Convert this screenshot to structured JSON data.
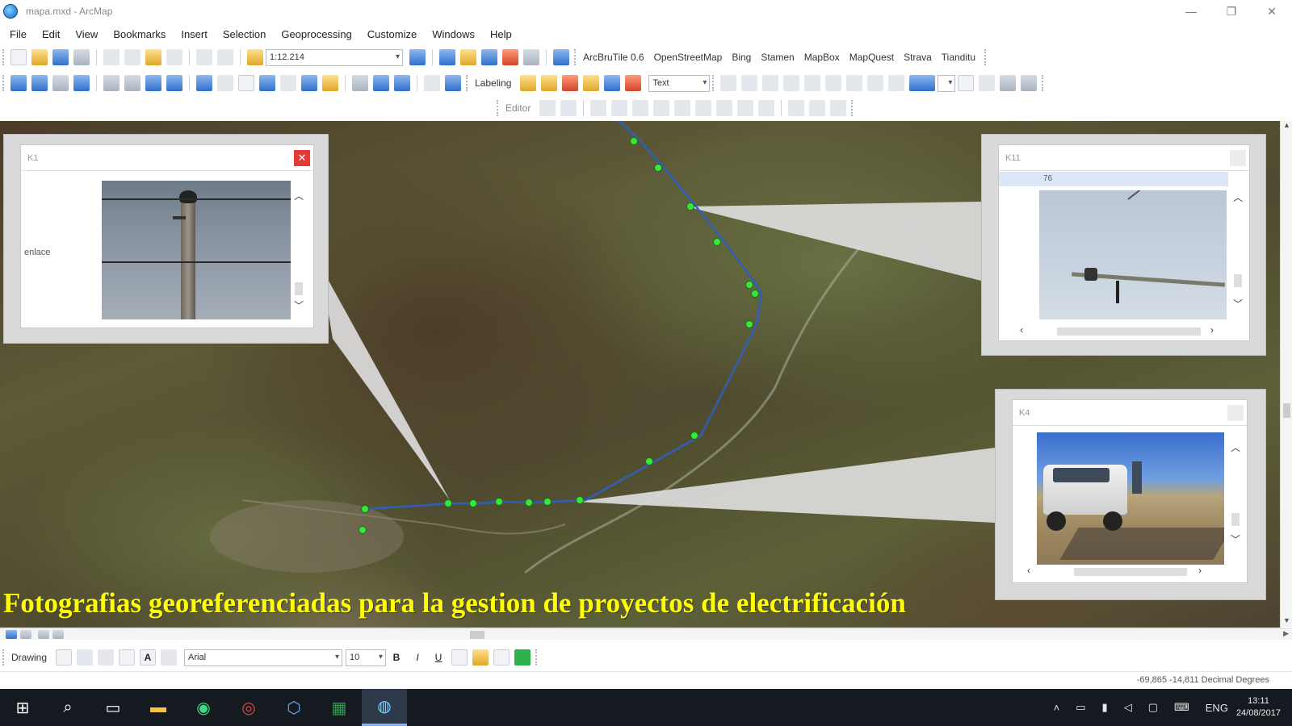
{
  "window": {
    "title": "mapa.mxd - ArcMap",
    "minimize": "—",
    "maximize": "❐",
    "close": "✕"
  },
  "menu": [
    "File",
    "Edit",
    "View",
    "Bookmarks",
    "Insert",
    "Selection",
    "Geoprocessing",
    "Customize",
    "Windows",
    "Help"
  ],
  "standard_toolbar": {
    "scale_value": "1:12.214",
    "arcbrutile_label": "ArcBruTile 0.6",
    "basemap_menus": [
      "OpenStreetMap",
      "Bing",
      "Stamen",
      "MapBox",
      "MapQuest",
      "Strava",
      "Tianditu"
    ]
  },
  "labeling_toolbar": {
    "label": "Labeling",
    "font_value": "Text"
  },
  "editor_toolbar": {
    "label": "Editor"
  },
  "map": {
    "caption": "Fotografias georeferenciadas para la gestion de proyectos de electrificación",
    "route_color": "#2f5fb8",
    "point_color": "#39e639"
  },
  "popups": {
    "k1": {
      "title": "K1",
      "field_label": "enlace",
      "close_icon": "close-icon",
      "close_color": "#e53935"
    },
    "k11": {
      "title": "K11",
      "row_value": "76"
    },
    "k4": {
      "title": "K4"
    }
  },
  "drawing_toolbar": {
    "label": "Drawing",
    "font_value": "Arial",
    "font_size": "10",
    "bold": "B",
    "italic": "I",
    "underline": "U"
  },
  "status": {
    "coordinates": "-69,865 -14,811 Decimal Degrees"
  },
  "taskbar": {
    "language": "ENG",
    "time": "13:11",
    "date": "24/08/2017"
  }
}
